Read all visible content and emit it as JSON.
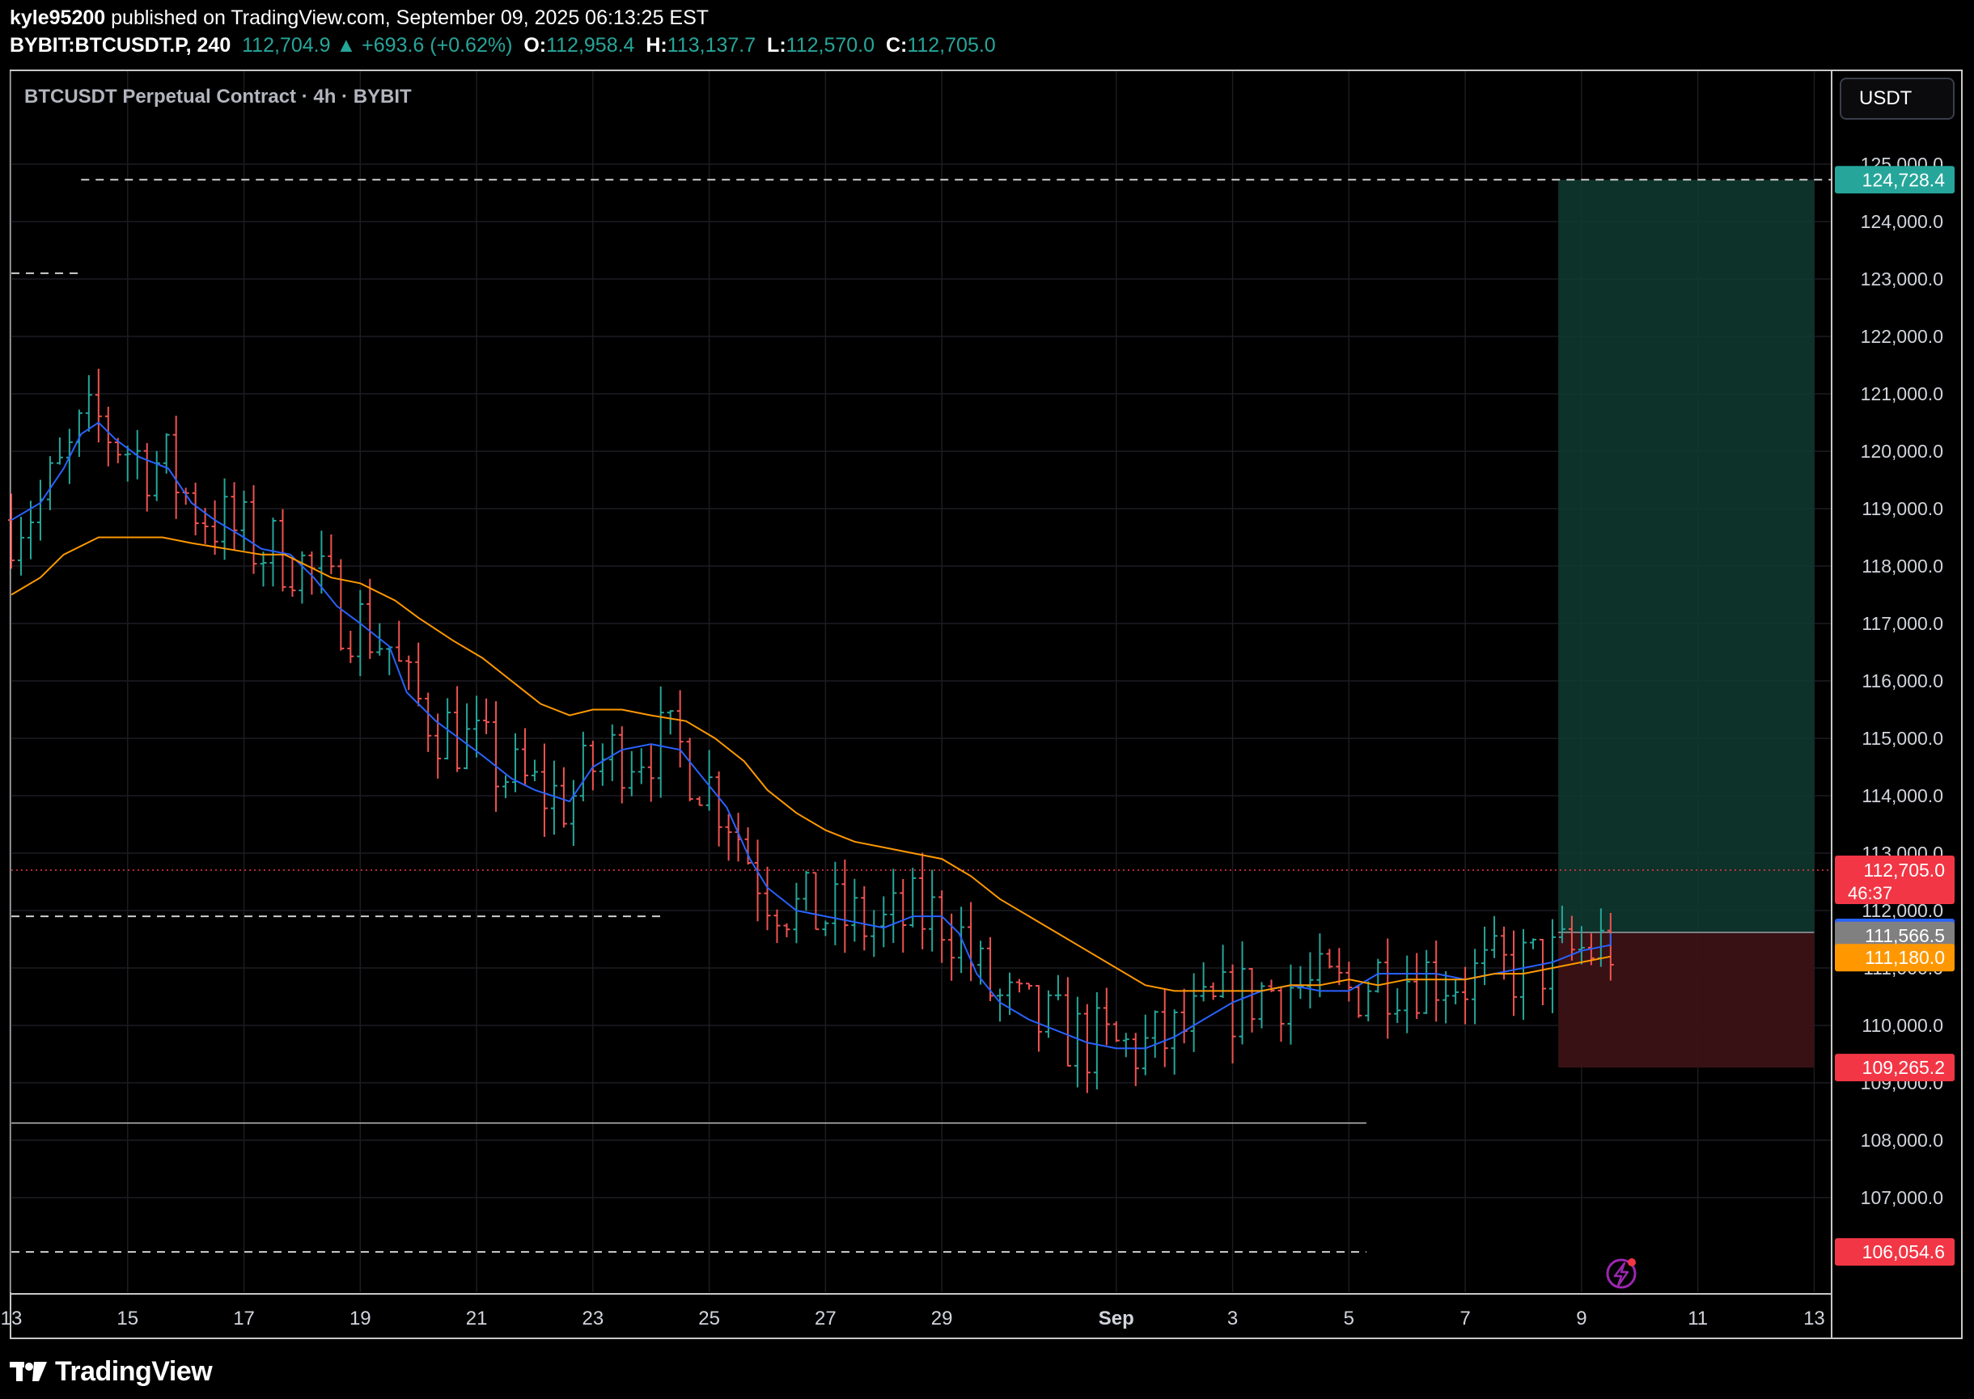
{
  "header": {
    "user": "kyle95200",
    "published": " published on TradingView.com, September 09, 2025 06:13:25 EST",
    "symbol": "BYBIT:BTCUSDT.P, 240",
    "last": "112,704.9",
    "change_arrow": "▲",
    "change": "+693.6 (+0.62%)",
    "o_label": "O:",
    "o": "112,958.4",
    "h_label": "H:",
    "h": "113,137.7",
    "l_label": "L:",
    "l": "112,570.0",
    "c_label": "C:",
    "c": "112,705.0"
  },
  "chart_title": "BTCUSDT Perpetual Contract · 4h · BYBIT",
  "currency_button": "USDT",
  "footer": {
    "brand": "TradingView",
    "logo_icon": "tradingview-logo-icon"
  },
  "colors": {
    "up": "#26a69a",
    "down": "#ef5350",
    "ema_fast": "#2962ff",
    "ema_slow": "#ff9800",
    "target_zone": "#0f3b31",
    "stop_zone": "#3b1215",
    "grid": "#1c1c22"
  },
  "chart_data": {
    "type": "candlestick",
    "title": "BTCUSDT Perpetual Contract · 4h · BYBIT",
    "timeframe": "4h",
    "y_axis": {
      "ticks": [
        "125,000.0",
        "124,000.0",
        "123,000.0",
        "122,000.0",
        "121,000.0",
        "120,000.0",
        "119,000.0",
        "118,000.0",
        "117,000.0",
        "116,000.0",
        "115,000.0",
        "114,000.0",
        "113,000.0",
        "112,000.0",
        "111,000.0",
        "110,000.0",
        "109,000.0",
        "108,000.0",
        "107,000.0"
      ],
      "ylim": [
        106000,
        125000
      ]
    },
    "x_axis": {
      "ticks": [
        "13",
        "15",
        "17",
        "19",
        "21",
        "23",
        "25",
        "27",
        "29",
        "Sep",
        "3",
        "5",
        "7",
        "9",
        "11",
        "13"
      ],
      "tick_days": [
        13,
        15,
        17,
        19,
        21,
        23,
        25,
        27,
        29,
        32,
        34,
        36,
        38,
        40,
        42,
        44
      ],
      "xlim": [
        13,
        44.3
      ]
    },
    "series": [
      {
        "name": "EMA fast",
        "points": [
          [
            13.0,
            118800
          ],
          [
            13.5,
            119100
          ],
          [
            13.9,
            119700
          ],
          [
            14.2,
            120300
          ],
          [
            14.5,
            120500
          ],
          [
            14.8,
            120200
          ],
          [
            15.2,
            119900
          ],
          [
            15.7,
            119700
          ],
          [
            16.1,
            119100
          ],
          [
            16.5,
            118800
          ],
          [
            17.0,
            118500
          ],
          [
            17.3,
            118300
          ],
          [
            17.8,
            118200
          ],
          [
            18.2,
            117800
          ],
          [
            18.6,
            117300
          ],
          [
            19.0,
            117000
          ],
          [
            19.5,
            116600
          ],
          [
            19.8,
            115800
          ],
          [
            20.3,
            115300
          ],
          [
            20.7,
            115000
          ],
          [
            21.1,
            114700
          ],
          [
            21.6,
            114300
          ],
          [
            22.0,
            114100
          ],
          [
            22.6,
            113900
          ],
          [
            23.0,
            114500
          ],
          [
            23.5,
            114800
          ],
          [
            24.0,
            114900
          ],
          [
            24.5,
            114800
          ],
          [
            24.9,
            114300
          ],
          [
            25.3,
            113800
          ],
          [
            25.7,
            112900
          ],
          [
            26.0,
            112400
          ],
          [
            26.5,
            112000
          ],
          [
            27.0,
            111900
          ],
          [
            27.5,
            111800
          ],
          [
            28.0,
            111700
          ],
          [
            28.5,
            111900
          ],
          [
            29.0,
            111900
          ],
          [
            29.3,
            111600
          ],
          [
            29.6,
            110900
          ],
          [
            30.0,
            110400
          ],
          [
            30.5,
            110100
          ],
          [
            31.0,
            109900
          ],
          [
            31.5,
            109700
          ],
          [
            32.0,
            109600
          ],
          [
            32.5,
            109600
          ],
          [
            33.0,
            109800
          ],
          [
            33.5,
            110100
          ],
          [
            34.0,
            110400
          ],
          [
            34.5,
            110600
          ],
          [
            35.0,
            110700
          ],
          [
            35.5,
            110600
          ],
          [
            36.0,
            110600
          ],
          [
            36.5,
            110900
          ],
          [
            37.0,
            110900
          ],
          [
            37.5,
            110900
          ],
          [
            38.0,
            110800
          ],
          [
            38.5,
            110900
          ],
          [
            39.0,
            111000
          ],
          [
            39.5,
            111100
          ],
          [
            40.0,
            111300
          ],
          [
            40.5,
            111400
          ],
          [
            40.5,
            111600
          ]
        ]
      },
      {
        "name": "EMA slow",
        "points": [
          [
            13.0,
            117500
          ],
          [
            13.5,
            117800
          ],
          [
            13.9,
            118200
          ],
          [
            14.5,
            118500
          ],
          [
            15.0,
            118500
          ],
          [
            15.6,
            118500
          ],
          [
            16.1,
            118400
          ],
          [
            16.7,
            118300
          ],
          [
            17.3,
            118200
          ],
          [
            17.7,
            118200
          ],
          [
            18.1,
            118000
          ],
          [
            18.5,
            117800
          ],
          [
            19.0,
            117700
          ],
          [
            19.6,
            117400
          ],
          [
            20.0,
            117100
          ],
          [
            20.6,
            116700
          ],
          [
            21.1,
            116400
          ],
          [
            21.6,
            116000
          ],
          [
            22.1,
            115600
          ],
          [
            22.6,
            115400
          ],
          [
            23.0,
            115500
          ],
          [
            23.5,
            115500
          ],
          [
            24.0,
            115400
          ],
          [
            24.6,
            115300
          ],
          [
            25.1,
            115000
          ],
          [
            25.6,
            114600
          ],
          [
            26.0,
            114100
          ],
          [
            26.5,
            113700
          ],
          [
            27.0,
            113400
          ],
          [
            27.5,
            113200
          ],
          [
            28.0,
            113100
          ],
          [
            28.5,
            113000
          ],
          [
            29.0,
            112900
          ],
          [
            29.5,
            112600
          ],
          [
            30.0,
            112200
          ],
          [
            30.5,
            111900
          ],
          [
            31.0,
            111600
          ],
          [
            31.5,
            111300
          ],
          [
            32.0,
            111000
          ],
          [
            32.5,
            110700
          ],
          [
            33.0,
            110600
          ],
          [
            33.5,
            110600
          ],
          [
            34.0,
            110600
          ],
          [
            34.5,
            110600
          ],
          [
            35.0,
            110700
          ],
          [
            35.5,
            110700
          ],
          [
            36.0,
            110800
          ],
          [
            36.5,
            110700
          ],
          [
            37.0,
            110800
          ],
          [
            37.5,
            110800
          ],
          [
            38.0,
            110800
          ],
          [
            38.5,
            110900
          ],
          [
            39.0,
            110900
          ],
          [
            39.5,
            111000
          ],
          [
            40.0,
            111100
          ],
          [
            40.5,
            111200
          ]
        ]
      }
    ],
    "horizontal_levels": [
      {
        "price": 124728.4,
        "label": "124,728.4",
        "style": "dashed",
        "x_from": 14.2
      },
      {
        "price": 123100,
        "style": "dashed",
        "x_from": 13,
        "x_to": 14.2
      },
      {
        "price": 111900,
        "style": "dashed",
        "x_from": 13,
        "x_to": 24.2
      },
      {
        "price": 108300,
        "style": "solid",
        "x_from": 13,
        "x_to": 36.3
      },
      {
        "price": 106054.6,
        "label": "106,054.6",
        "style": "dashed",
        "x_from": 13,
        "x_to": 36.3
      },
      {
        "price": 112705.0,
        "label": "112,705.0",
        "style": "dotted-current"
      }
    ],
    "price_labels": [
      {
        "value": 124728.4,
        "text": "124,728.4",
        "color": "#26a69a"
      },
      {
        "value": 112705.0,
        "text": "112,705.0",
        "sub": "46:37",
        "color": "#f23645"
      },
      {
        "value": 111620.0,
        "text": "111,620.0",
        "color": "#2962ff"
      },
      {
        "value": 111566.5,
        "text": "111,566.5",
        "color": "#808080"
      },
      {
        "value": 111180.0,
        "text": "111,180.0",
        "color": "#ff9800"
      },
      {
        "value": 109265.2,
        "text": "109,265.2",
        "color": "#f23645"
      },
      {
        "value": 106054.6,
        "text": "106,054.6",
        "color": "#f23645"
      }
    ],
    "long_position": {
      "x_from": 39.6,
      "x_to": 44.0,
      "entry": 111620.0,
      "target": 124728.4,
      "stop": 109265.2
    }
  }
}
